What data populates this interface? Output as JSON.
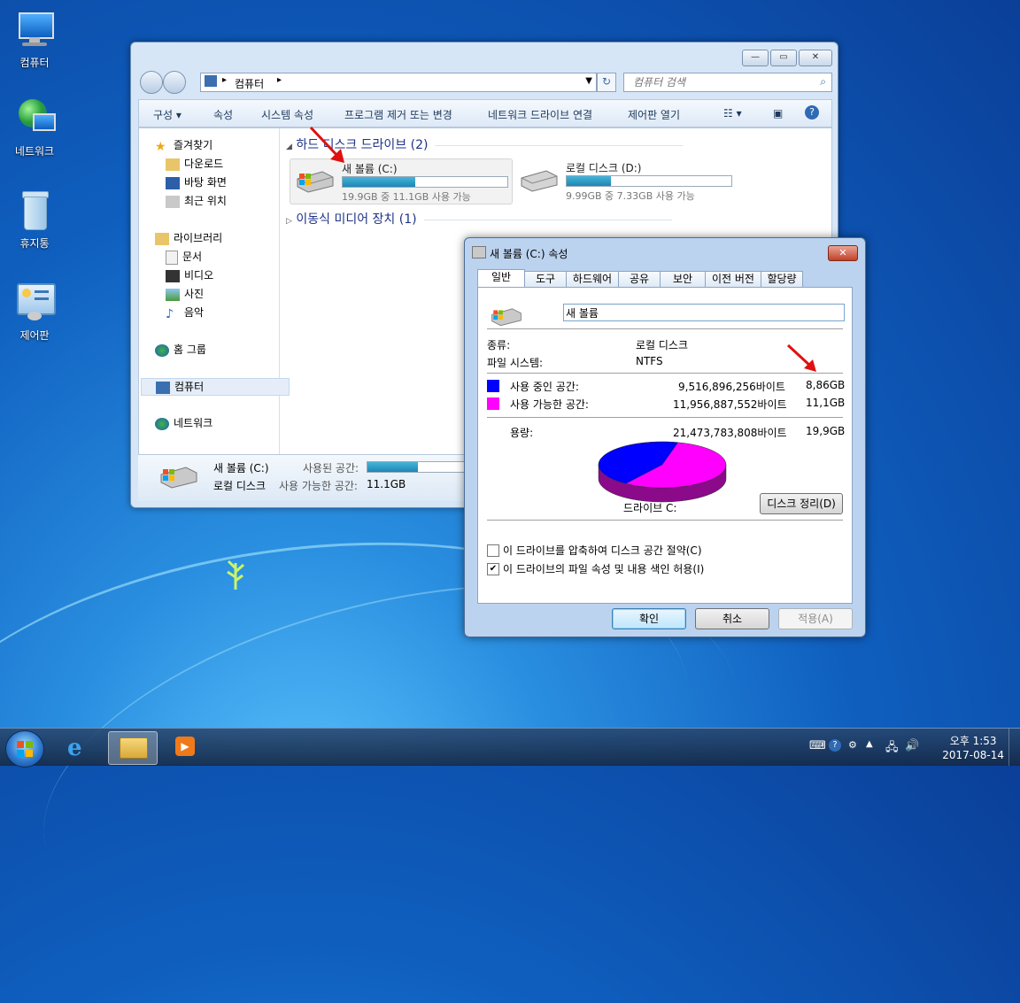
{
  "desktop": {
    "icons": [
      {
        "label": "컴퓨터",
        "icon": "computer-icon"
      },
      {
        "label": "네트워크",
        "icon": "network-icon"
      },
      {
        "label": "휴지통",
        "icon": "recycle-bin-icon"
      },
      {
        "label": "제어판",
        "icon": "control-panel-icon"
      }
    ]
  },
  "explorer": {
    "address": "컴퓨터",
    "search_placeholder": "컴퓨터 검색",
    "toolbar": {
      "organize": "구성",
      "properties": "속성",
      "system_properties": "시스템 속성",
      "uninstall": "프로그램 제거 또는 변경",
      "map_drive": "네트워크 드라이브 연결",
      "control_panel": "제어판 열기"
    },
    "nav": {
      "favorites": "즐겨찾기",
      "downloads": "다운로드",
      "desktop": "바탕 화면",
      "recent": "최근 위치",
      "libraries": "라이브러리",
      "documents": "문서",
      "videos": "비디오",
      "pictures": "사진",
      "music": "음악",
      "homegroup": "홈 그룹",
      "computer": "컴퓨터",
      "network": "네트워크"
    },
    "groups": {
      "hdd": "하드 디스크 드라이브 (2)",
      "removable": "이동식 미디어 장치 (1)"
    },
    "drives": [
      {
        "name": "새 볼륨 (C:)",
        "free_text": "19.9GB 중 11.1GB 사용 가능",
        "used_fraction": 0.44
      },
      {
        "name": "로컬 디스크 (D:)",
        "free_text": "9.99GB 중 7.33GB 사용 가능",
        "used_fraction": 0.27
      }
    ],
    "details": {
      "name": "새 볼륨 (C:)",
      "type": "로컬 디스크",
      "used_label": "사용된 공간:",
      "free_label": "사용 가능한 공간:",
      "free_value": "11.1GB",
      "used_fraction": 0.44
    }
  },
  "properties": {
    "title": "새 볼륨 (C:) 속성",
    "tabs": [
      "일반",
      "도구",
      "하드웨어",
      "공유",
      "보안",
      "이전 버전",
      "할당량"
    ],
    "active_tab": "일반",
    "volume_name": "새 볼륨",
    "type_label": "종류:",
    "type_value": "로컬 디스크",
    "fs_label": "파일 시스템:",
    "fs_value": "NTFS",
    "used_label": "사용 중인 공간:",
    "used_bytes": "9,516,896,256바이트",
    "used_gb": "8,86GB",
    "free_label": "사용 가능한 공간:",
    "free_bytes": "11,956,887,552바이트",
    "free_gb": "11,1GB",
    "capacity_label": "용량:",
    "capacity_bytes": "21,473,783,808바이트",
    "capacity_gb": "19,9GB",
    "drive_label": "드라이브 C:",
    "cleanup": "디스크 정리(D)",
    "compress": "이 드라이브를 압축하여 디스크 공간 절약(C)",
    "index": "이 드라이브의 파일 속성 및 내용 색인 허용(I)",
    "compress_checked": false,
    "index_checked": true,
    "ok": "확인",
    "cancel": "취소",
    "apply": "적용(A)",
    "used_color": "#0000ff",
    "free_color": "#ff00ff",
    "used_fraction": 0.443
  },
  "taskbar": {
    "time": "오후 1:53",
    "date": "2017-08-14"
  }
}
